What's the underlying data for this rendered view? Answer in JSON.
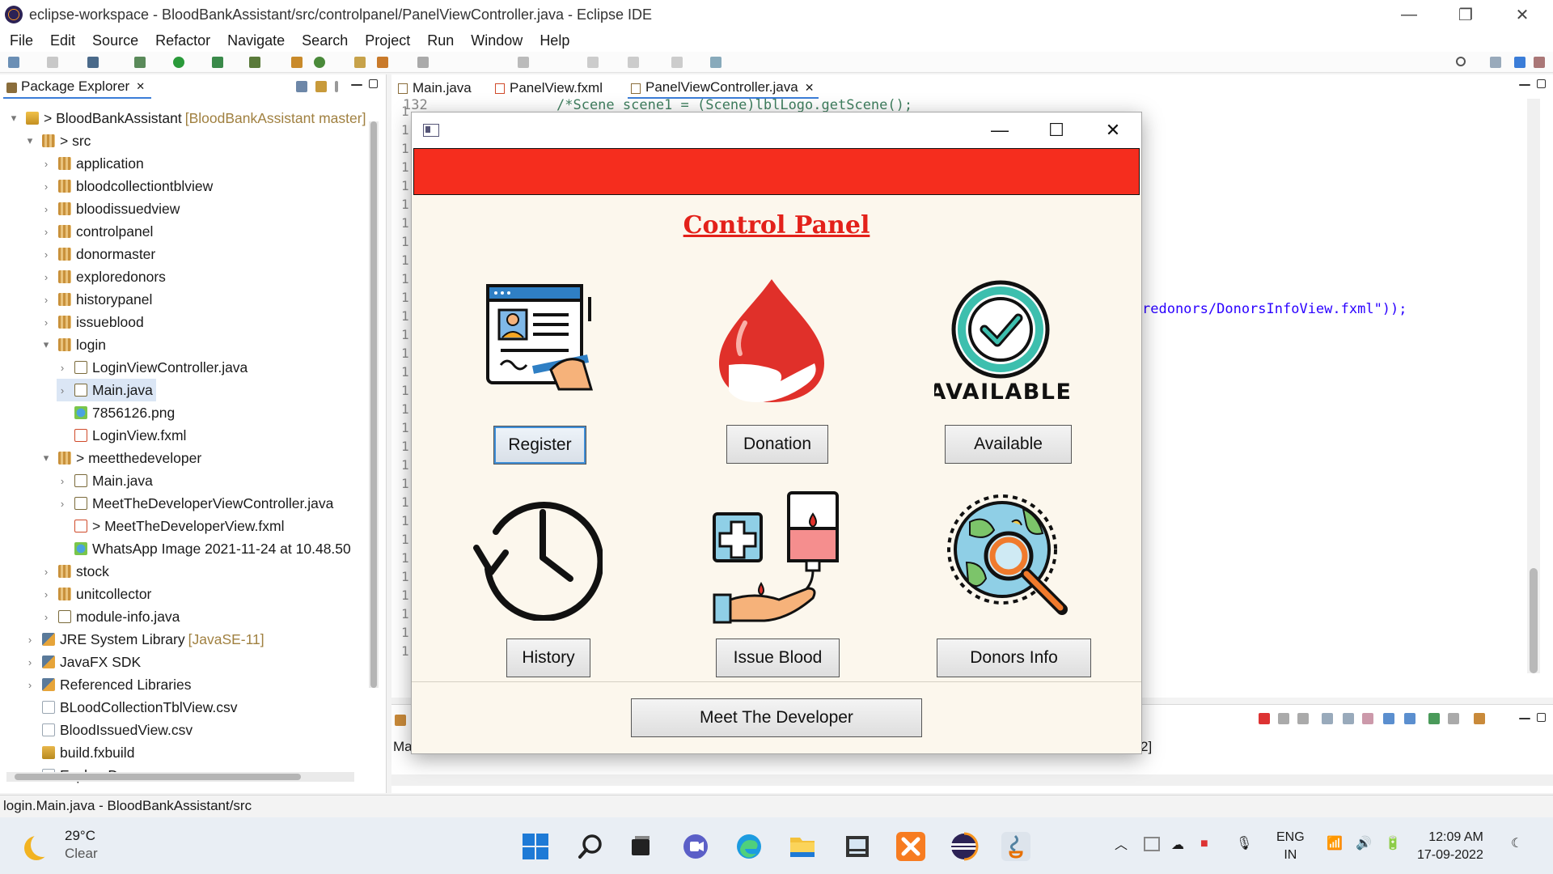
{
  "window": {
    "title": "eclipse-workspace - BloodBankAssistant/src/controlpanel/PanelViewController.java - Eclipse IDE",
    "controls": [
      "—",
      "❐",
      "✕"
    ]
  },
  "menu": [
    "File",
    "Edit",
    "Source",
    "Refactor",
    "Navigate",
    "Search",
    "Project",
    "Run",
    "Window",
    "Help"
  ],
  "package_explorer": {
    "tab_label": "Package Explorer",
    "close": "✕",
    "items": [
      {
        "label": "> BloodBankAssistant",
        "decoration": "[BloodBankAssistant master]",
        "icon": "project-icon"
      },
      {
        "label": "> src",
        "decoration": "",
        "icon": "source-folder-icon"
      },
      {
        "label": "application",
        "decoration": "",
        "icon": "package-icon"
      },
      {
        "label": "bloodcollectiontblview",
        "decoration": "",
        "icon": "package-icon"
      },
      {
        "label": "bloodissuedview",
        "decoration": "",
        "icon": "package-icon"
      },
      {
        "label": "controlpanel",
        "decoration": "",
        "icon": "package-icon"
      },
      {
        "label": "donormaster",
        "decoration": "",
        "icon": "package-icon"
      },
      {
        "label": "exploredonors",
        "decoration": "",
        "icon": "package-icon"
      },
      {
        "label": "historypanel",
        "decoration": "",
        "icon": "package-icon"
      },
      {
        "label": "issueblood",
        "decoration": "",
        "icon": "package-icon"
      },
      {
        "label": "login",
        "decoration": "",
        "icon": "package-icon"
      },
      {
        "label": "LoginViewController.java",
        "decoration": "",
        "icon": "java-file-icon"
      },
      {
        "label": "Main.java",
        "decoration": "",
        "icon": "java-file-icon"
      },
      {
        "label": "7856126.png",
        "decoration": "",
        "icon": "image-file-icon"
      },
      {
        "label": "LoginView.fxml",
        "decoration": "",
        "icon": "fxml-file-icon"
      },
      {
        "label": "> meetthedeveloper",
        "decoration": "",
        "icon": "package-icon"
      },
      {
        "label": "Main.java",
        "decoration": "",
        "icon": "java-file-icon"
      },
      {
        "label": "MeetTheDeveloperViewController.java",
        "decoration": "",
        "icon": "java-file-icon"
      },
      {
        "label": "> MeetTheDeveloperView.fxml",
        "decoration": "",
        "icon": "fxml-file-icon"
      },
      {
        "label": "WhatsApp Image 2021-11-24 at 10.48.50",
        "decoration": "",
        "icon": "image-file-icon"
      },
      {
        "label": "stock",
        "decoration": "",
        "icon": "package-icon"
      },
      {
        "label": "unitcollector",
        "decoration": "",
        "icon": "package-icon"
      },
      {
        "label": "module-info.java",
        "decoration": "",
        "icon": "java-file-icon"
      },
      {
        "label": "JRE System Library",
        "decoration": "[JavaSE-11]",
        "icon": "library-icon"
      },
      {
        "label": "JavaFX SDK",
        "decoration": "",
        "icon": "library-icon"
      },
      {
        "label": "Referenced Libraries",
        "decoration": "",
        "icon": "library-icon"
      },
      {
        "label": "BLoodCollectionTblView.csv",
        "decoration": "",
        "icon": "csv-file-icon"
      },
      {
        "label": "BloodIssuedView.csv",
        "decoration": "",
        "icon": "csv-file-icon"
      },
      {
        "label": "build.fxbuild",
        "decoration": "",
        "icon": "build-file-icon"
      },
      {
        "label": "ExploreDonors.csv",
        "decoration": "",
        "icon": "csv-file-icon"
      }
    ]
  },
  "editor": {
    "tabs": [
      {
        "label": "Main.java",
        "active": false
      },
      {
        "label": "PanelView.fxml",
        "active": false
      },
      {
        "label": "PanelViewController.java",
        "active": true,
        "close": "✕"
      }
    ],
    "first_line_number": "132",
    "gutter_digit": "1",
    "code_top": "/*Scene scene1 = (Scene)lblLogo.getScene();",
    "code_right": "redonors/DonorsInfoView.fxml\"));"
  },
  "console": {
    "tab_fragment": "Ma",
    "right_fragment": "2]"
  },
  "status": {
    "text": "login.Main.java - BloodBankAssistant/src"
  },
  "app": {
    "heading": "Control Panel",
    "available_art_text": "AVAILABLE",
    "buttons": {
      "register": "Register",
      "donation": "Donation",
      "available": "Available",
      "history": "History",
      "issue_blood": "Issue Blood",
      "donors_info": "Donors Info",
      "meet_developer": "Meet The Developer"
    },
    "colors": {
      "banner": "#f52d1e",
      "heading": "#e3211a",
      "background": "#fcf7ed"
    }
  },
  "taskbar": {
    "weather_temp": "29°C",
    "weather_desc": "Clear",
    "language_1": "ENG",
    "language_2": "IN",
    "time": "12:09 AM",
    "date": "17-09-2022"
  }
}
